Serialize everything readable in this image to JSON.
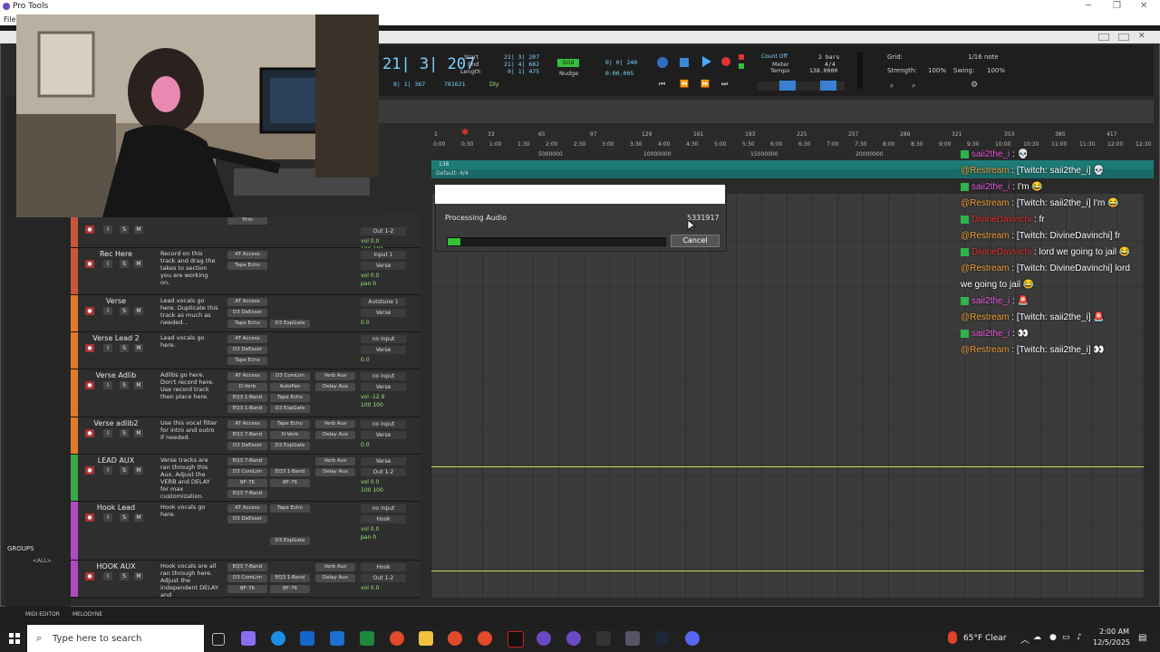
{
  "window": {
    "title": "Pro Tools",
    "menu_first": "File"
  },
  "transport": {
    "main_counter": "21| 3| 207",
    "start_label": "Start",
    "start_value": "21| 3| 207",
    "end_label": "End",
    "end_value": "21| 4| 682",
    "length_label": "Length",
    "length_value": "0| 1| 475",
    "sub_counter": "8| 1| 367",
    "sub_counter2": "781621",
    "dly_label": "Dly",
    "grid_mode": "Grid",
    "nudge_label": "Nudge",
    "grid_value": "0| 0| 240",
    "nudge_value": "0:00.005",
    "count_off": "Count Off",
    "meter_label": "Meter",
    "tempo_label": "Tempo",
    "bars_value": "2 bars",
    "meter_value": "4/4",
    "tempo_value": "138.0000",
    "grid_right_label": "Grid:",
    "grid_right_value": "1/16 note",
    "strength_label": "Strength:",
    "strength_value": "100%",
    "swing_label": "Swing:",
    "swing_value": "100%"
  },
  "ruler": {
    "bars": [
      "1",
      "33",
      "65",
      "97",
      "129",
      "161",
      "193",
      "225",
      "257",
      "289",
      "321",
      "353",
      "385",
      "417"
    ],
    "times": [
      "0:00",
      "0:30",
      "1:00",
      "1:30",
      "2:00",
      "2:30",
      "3:00",
      "3:30",
      "4:00",
      "4:30",
      "5:00",
      "5:30",
      "6:00",
      "6:30",
      "7:00",
      "7:30",
      "8:00",
      "8:30",
      "9:00",
      "9:30",
      "10:00",
      "10:30",
      "11:00",
      "11:30",
      "12:00",
      "12:30"
    ],
    "samples": [
      "5000000",
      "10000000",
      "15000000",
      "20000000"
    ],
    "tempo_marker": "138",
    "meter_marker": "Default: 4/4"
  },
  "dialog": {
    "message": "Processing Audio",
    "counter": "5331917",
    "progress": 0.06,
    "cancel_label": "Cancel"
  },
  "tracks": [
    {
      "name": "",
      "color": "#c8573a",
      "comment": "",
      "inserts": [
        "Trim"
      ],
      "io_in": "",
      "io_out": "Out 1-2",
      "vol": "vol",
      "vol_value": "0.0",
      "pan": "100  100"
    },
    {
      "name": "Rec Here",
      "color": "#c8573a",
      "comment": "Record on this track and drag the takes to section you are working on.",
      "inserts": [
        "AT Access",
        "Tape Echo"
      ],
      "io_in": "Input 1",
      "io_out": "Verse",
      "vol": "vol",
      "vol_value": "0.0",
      "pan": "pan  0"
    },
    {
      "name": "Verse",
      "color": "#e07a2a",
      "comment": "Lead vocals go here. Duplicate this track as much as needed...",
      "inserts": [
        "AT Access",
        "D3 DeEsser",
        "Tape Echo"
      ],
      "inserts2": [
        "",
        "",
        "D3 ExpGate"
      ],
      "io_in": "Autotune 1",
      "io_out": "Verse",
      "vol": "",
      "vol_value": "0.0",
      "pan": ""
    },
    {
      "name": "Verse Lead 2",
      "color": "#e07a2a",
      "comment": "Lead vocals go here.",
      "inserts": [
        "AT Access",
        "D3 DeEsser",
        "Tape Echo"
      ],
      "io_in": "no input",
      "io_out": "Verse",
      "vol": "",
      "vol_value": "0.0",
      "pan": ""
    },
    {
      "name": "Verse Adlib",
      "color": "#e07a2a",
      "comment": "Adlibs go here. Don't record here. Use record track then place here.",
      "inserts": [
        "AT Access",
        "D-Verb",
        "EQ3 1-Band",
        "EQ3 1-Band"
      ],
      "inserts2": [
        "D3 ComLim",
        "AutoPan",
        "Tape Echo",
        "D3 ExpGate"
      ],
      "sends": [
        "Verb Aux",
        "Delay Aux"
      ],
      "io_in": "no input",
      "io_out": "Verse",
      "vol": "vol",
      "vol_value": "-12.9",
      "pan": "100  100"
    },
    {
      "name": "Verse adlib2",
      "color": "#e07a2a",
      "comment": "Use this vocal filter for intro and outro if needed.",
      "inserts": [
        "AT Access",
        "EQ3 7-Band",
        "D3 DeEsser"
      ],
      "inserts2": [
        "Tape Echo",
        "D-Verb",
        "D3 ExpGate"
      ],
      "sends": [
        "Verb Aux",
        "Delay Aux"
      ],
      "io_in": "no input",
      "io_out": "Verse",
      "vol": "",
      "vol_value": "0.0",
      "pan": ""
    },
    {
      "name": "LEAD AUX",
      "color": "#3aa84a",
      "comment": "Verse tracks are ran through this Aux. Adjust the VERB and DELAY for max customization.",
      "inserts": [
        "EQ3 7-Band",
        "D3 ComLim",
        "BF-76",
        "EQ3 7-Band"
      ],
      "inserts2": [
        "",
        "EQ3 1-Band",
        "BF-76",
        ""
      ],
      "sends": [
        "Verb Aux",
        "Delay Aux"
      ],
      "io_in": "Verse",
      "io_out": "Out 1-2",
      "vol": "vol",
      "vol_value": "0.0",
      "pan": "100  100"
    },
    {
      "name": "Hook Lead",
      "color": "#b04ac0",
      "comment": "Hook vocals go here.",
      "inserts": [
        "AT Access",
        "D3 DeEsser"
      ],
      "inserts2": [
        "Tape Echo",
        "",
        "",
        "D3 ExpGate"
      ],
      "io_in": "no input",
      "io_out": "Hook",
      "vol": "vol",
      "vol_value": "0.0",
      "pan": "pan  0"
    },
    {
      "name": "HOOK AUX",
      "color": "#b04ac0",
      "comment": "Hook vocals are all ran through here. Adjust the independent DELAY and",
      "inserts": [
        "EQ3 7-Band",
        "D3 ComLim",
        "BF-76"
      ],
      "inserts2": [
        "",
        "EQ3 1-Band",
        "BF-76"
      ],
      "sends": [
        "Verb Aux",
        "Delay Aux"
      ],
      "io_in": "Hook",
      "io_out": "Out 1-2",
      "vol": "vol",
      "vol_value": "0.0",
      "pan": ""
    }
  ],
  "groups": {
    "label": "GROUPS",
    "all": "<ALL>"
  },
  "bottom": {
    "midi_editor": "MIDI EDITOR",
    "melodyne": "MELODYNE"
  },
  "chat": [
    {
      "user": "saii2the_i",
      "user_color": "saii",
      "text": " : 💀"
    },
    {
      "user": "@Restream",
      "user_color": "restream",
      "text": " : [Twitch: saii2the_i] 💀"
    },
    {
      "user": "saii2the_i",
      "user_color": "saii",
      "text": " : I'm 😂"
    },
    {
      "user": "@Restream",
      "user_color": "restream",
      "text": " : [Twitch: saii2the_i] I'm 😂"
    },
    {
      "user": "DivineDavinchi",
      "user_color": "divine",
      "text": " : fr"
    },
    {
      "user": "@Restream",
      "user_color": "restream",
      "text": " : [Twitch: DivineDavinchi] fr"
    },
    {
      "user": "DivineDavinchi",
      "user_color": "divine",
      "text": " : lord we going to jail 😂"
    },
    {
      "user": "@Restream",
      "user_color": "restream",
      "text": " : [Twitch: DivineDavinchi] lord we going to jail 😂"
    },
    {
      "user": "saii2the_i",
      "user_color": "saii",
      "text": " : 🚨"
    },
    {
      "user": "@Restream",
      "user_color": "restream",
      "text": " : [Twitch: saii2the_i] 🚨"
    },
    {
      "user": "saii2the_i",
      "user_color": "saii",
      "text": " : 👀"
    },
    {
      "user": "@Restream",
      "user_color": "restream",
      "text": " : [Twitch: saii2the_i] 👀"
    }
  ],
  "taskbar": {
    "search_placeholder": "Type here to search",
    "weather": "65°F Clear",
    "time": "2:00 AM",
    "date": "12/5/2025"
  },
  "colors": {
    "accent_blue": "#7dd0ff",
    "record_red": "#e03030",
    "tempo_teal": "#1d7b78",
    "progress_green": "#35c03a"
  }
}
